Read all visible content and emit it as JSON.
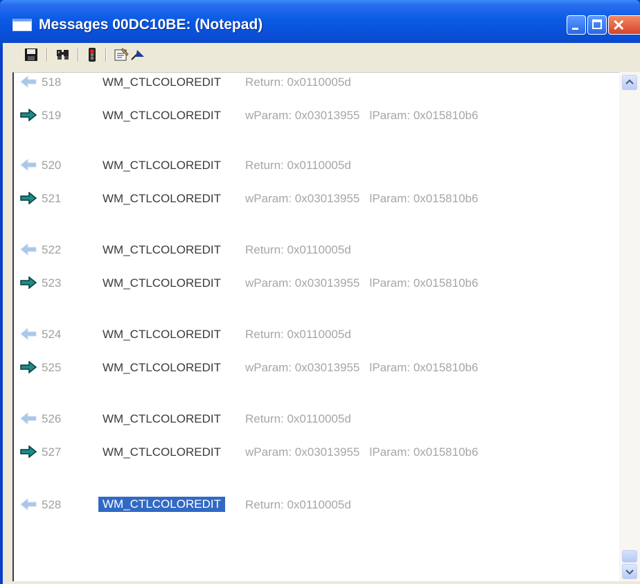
{
  "window": {
    "title": "Messages 00DC10BE: (Notepad)",
    "buttons": {
      "minimize": "minimize",
      "maximize": "maximize",
      "close": "close"
    }
  },
  "toolbar": {
    "icons": [
      "save-icon",
      "find-icon",
      "stop-logging-icon",
      "properties-icon",
      "jump-icon"
    ]
  },
  "colors": {
    "sent_arrow": "#1a8c8c",
    "return_arrow": "#a9c7e6",
    "selection": "#316ac5"
  },
  "messages": [
    {
      "dir": "return",
      "num": "518",
      "name": "WM_CTLCOLOREDIT",
      "params": "Return: 0x0110005d"
    },
    {
      "dir": "sent",
      "num": "519",
      "name": "WM_CTLCOLOREDIT",
      "params": "wParam: 0x03013955   lParam: 0x015810b6"
    },
    {
      "dir": "return",
      "num": "520",
      "name": "WM_CTLCOLOREDIT",
      "params": "Return: 0x0110005d"
    },
    {
      "dir": "sent",
      "num": "521",
      "name": "WM_CTLCOLOREDIT",
      "params": "wParam: 0x03013955   lParam: 0x015810b6"
    },
    {
      "dir": "return",
      "num": "522",
      "name": "WM_CTLCOLOREDIT",
      "params": "Return: 0x0110005d"
    },
    {
      "dir": "sent",
      "num": "523",
      "name": "WM_CTLCOLOREDIT",
      "params": "wParam: 0x03013955   lParam: 0x015810b6"
    },
    {
      "dir": "return",
      "num": "524",
      "name": "WM_CTLCOLOREDIT",
      "params": "Return: 0x0110005d"
    },
    {
      "dir": "sent",
      "num": "525",
      "name": "WM_CTLCOLOREDIT",
      "params": "wParam: 0x03013955   lParam: 0x015810b6"
    },
    {
      "dir": "return",
      "num": "526",
      "name": "WM_CTLCOLOREDIT",
      "params": "Return: 0x0110005d"
    },
    {
      "dir": "sent",
      "num": "527",
      "name": "WM_CTLCOLOREDIT",
      "params": "wParam: 0x03013955   lParam: 0x015810b6"
    },
    {
      "dir": "return",
      "num": "528",
      "name": "WM_CTLCOLOREDIT",
      "params": "Return: 0x0110005d",
      "selected": true
    }
  ]
}
